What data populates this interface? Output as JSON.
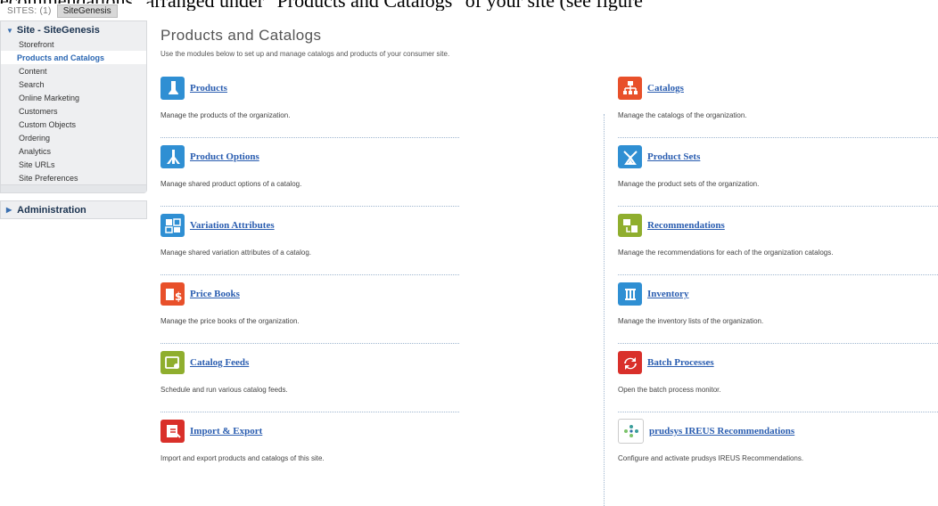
{
  "caption": "ecommendations\" arranged under \"Products and Catalogs\" of your site (see figure",
  "sites_bar": {
    "label": "SITES: (1)",
    "site": "SiteGenesis"
  },
  "sidebar": {
    "site_header": "Site - SiteGenesis",
    "items": [
      "Storefront",
      "Products and Catalogs",
      "Content",
      "Search",
      "Online Marketing",
      "Customers",
      "Custom Objects",
      "Ordering",
      "Analytics",
      "Site URLs",
      "Site Preferences"
    ],
    "active_index": 1,
    "admin_header": "Administration"
  },
  "main": {
    "title": "Products and Catalogs",
    "subtitle": "Use the modules below to set up and manage catalogs and products of your consumer site.",
    "left_modules": [
      {
        "title": "Products",
        "desc": "Manage the products of the organization.",
        "icon": "products-icon",
        "color": "#2f8fd3"
      },
      {
        "title": "Product Options",
        "desc": "Manage shared product options of a catalog.",
        "icon": "product-options-icon",
        "color": "#2f8fd3"
      },
      {
        "title": "Variation Attributes",
        "desc": "Manage shared variation attributes of a catalog.",
        "icon": "variation-attributes-icon",
        "color": "#2f8fd3"
      },
      {
        "title": "Price Books",
        "desc": "Manage the price books of the organization.",
        "icon": "price-books-icon",
        "color": "#e8502a"
      },
      {
        "title": "Catalog Feeds",
        "desc": "Schedule and run various catalog feeds.",
        "icon": "catalog-feeds-icon",
        "color": "#8fae2e"
      },
      {
        "title": "Import & Export",
        "desc": "Import and export products and catalogs of this site.",
        "icon": "import-export-icon",
        "color": "#d9302a"
      }
    ],
    "right_modules": [
      {
        "title": "Catalogs",
        "desc": "Manage the catalogs of the organization.",
        "icon": "catalogs-icon",
        "color": "#e8502a"
      },
      {
        "title": "Product Sets",
        "desc": "Manage the product sets of the organization.",
        "icon": "product-sets-icon",
        "color": "#2f8fd3"
      },
      {
        "title": "Recommendations",
        "desc": "Manage the recommendations for each of the organization catalogs.",
        "icon": "recommendations-icon",
        "color": "#8fae2e"
      },
      {
        "title": "Inventory",
        "desc": "Manage the inventory lists of the organization.",
        "icon": "inventory-icon",
        "color": "#2f8fd3"
      },
      {
        "title": "Batch Processes",
        "desc": "Open the batch process monitor.",
        "icon": "batch-processes-icon",
        "color": "#d9302a"
      },
      {
        "title": "prudsys IREUS Recommendations",
        "desc": "Configure and activate prudsys IREUS Recommendations.",
        "icon": "prudsys-icon",
        "color": "#ffffff"
      }
    ]
  }
}
